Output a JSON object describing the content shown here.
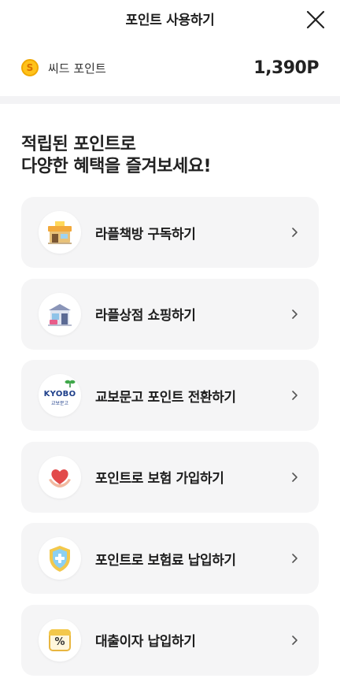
{
  "header": {
    "title": "포인트 사용하기",
    "close_icon": "close-icon"
  },
  "balance": {
    "coin_symbol": "S",
    "label": "씨드 포인트",
    "value": "1,390P"
  },
  "headline": {
    "line1": "적립된 포인트로",
    "line2": "다양한 혜택을 즐겨보세요!"
  },
  "menu": [
    {
      "label": "라플책방 구독하기",
      "icon": "bookstore-icon"
    },
    {
      "label": "라플상점 쇼핑하기",
      "icon": "shop-icon"
    },
    {
      "label": "교보문고 포인트 전환하기",
      "icon": "kyobo-logo-icon",
      "logo_text": "KYOBO",
      "logo_sub": "교보문고"
    },
    {
      "label": "포인트로 보험 가입하기",
      "icon": "heart-hands-icon"
    },
    {
      "label": "포인트로 보험료 납입하기",
      "icon": "shield-plus-icon"
    },
    {
      "label": "대출이자 납입하기",
      "icon": "percent-calendar-icon",
      "symbol": "%"
    }
  ],
  "colors": {
    "coin": "#ffc21a",
    "card_bg": "#f5f5f6",
    "divider": "#f3f3f5"
  }
}
